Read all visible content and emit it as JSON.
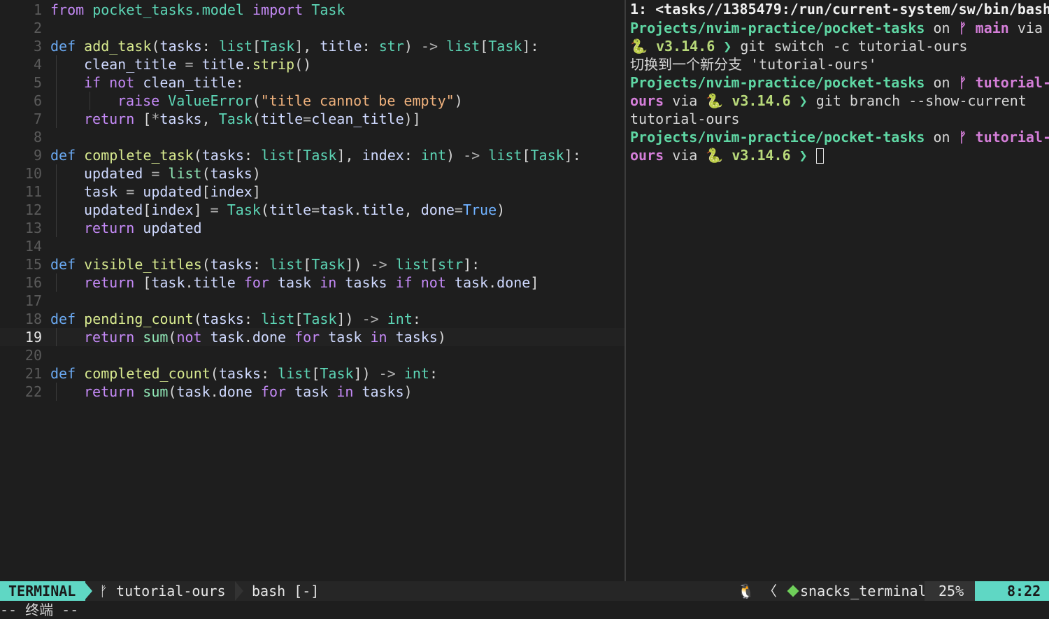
{
  "editor": {
    "current_line": 19,
    "lines": [
      {
        "n": "1",
        "tokens": [
          [
            "kw",
            "from"
          ],
          [
            "pu",
            " "
          ],
          [
            "ty",
            "pocket_tasks.model"
          ],
          [
            "pu",
            " "
          ],
          [
            "kw",
            "import"
          ],
          [
            "pu",
            " "
          ],
          [
            "ty",
            "Task"
          ]
        ]
      },
      {
        "n": "2",
        "tokens": []
      },
      {
        "n": "3",
        "tokens": [
          [
            "def",
            "def"
          ],
          [
            "pu",
            " "
          ],
          [
            "fn",
            "add_task"
          ],
          [
            "pu",
            "("
          ],
          [
            "pm",
            "tasks"
          ],
          [
            "pu",
            ": "
          ],
          [
            "ty",
            "list"
          ],
          [
            "pu",
            "["
          ],
          [
            "ty",
            "Task"
          ],
          [
            "pu",
            "], "
          ],
          [
            "pm",
            "title"
          ],
          [
            "pu",
            ": "
          ],
          [
            "ty",
            "str"
          ],
          [
            "pu",
            ") "
          ],
          [
            "op",
            "->"
          ],
          [
            "pu",
            " "
          ],
          [
            "ty",
            "list"
          ],
          [
            "pu",
            "["
          ],
          [
            "ty",
            "Task"
          ],
          [
            "pu",
            "]:"
          ]
        ]
      },
      {
        "n": "4",
        "indent": 1,
        "tokens": [
          [
            "var",
            "clean_title"
          ],
          [
            "op",
            " = "
          ],
          [
            "var",
            "title"
          ],
          [
            "pu",
            "."
          ],
          [
            "fn",
            "strip"
          ],
          [
            "pu",
            "()"
          ]
        ]
      },
      {
        "n": "5",
        "indent": 1,
        "tokens": [
          [
            "kw",
            "if"
          ],
          [
            "pu",
            " "
          ],
          [
            "kw",
            "not"
          ],
          [
            "pu",
            " "
          ],
          [
            "var",
            "clean_title"
          ],
          [
            "pu",
            ":"
          ]
        ]
      },
      {
        "n": "6",
        "indent": 2,
        "tokens": [
          [
            "kw",
            "raise"
          ],
          [
            "pu",
            " "
          ],
          [
            "ty",
            "ValueError"
          ],
          [
            "pu",
            "("
          ],
          [
            "st",
            "\"title cannot be empty\""
          ],
          [
            "pu",
            ")"
          ]
        ]
      },
      {
        "n": "7",
        "indent": 1,
        "tokens": [
          [
            "kw",
            "return"
          ],
          [
            "pu",
            " ["
          ],
          [
            "op",
            "*"
          ],
          [
            "var",
            "tasks"
          ],
          [
            "pu",
            ", "
          ],
          [
            "ty",
            "Task"
          ],
          [
            "pu",
            "("
          ],
          [
            "pm",
            "title"
          ],
          [
            "op",
            "="
          ],
          [
            "var",
            "clean_title"
          ],
          [
            "pu",
            ")]"
          ]
        ]
      },
      {
        "n": "8",
        "tokens": []
      },
      {
        "n": "9",
        "tokens": [
          [
            "def",
            "def"
          ],
          [
            "pu",
            " "
          ],
          [
            "fn",
            "complete_task"
          ],
          [
            "pu",
            "("
          ],
          [
            "pm",
            "tasks"
          ],
          [
            "pu",
            ": "
          ],
          [
            "ty",
            "list"
          ],
          [
            "pu",
            "["
          ],
          [
            "ty",
            "Task"
          ],
          [
            "pu",
            "], "
          ],
          [
            "pm",
            "index"
          ],
          [
            "pu",
            ": "
          ],
          [
            "ty",
            "int"
          ],
          [
            "pu",
            ") "
          ],
          [
            "op",
            "->"
          ],
          [
            "pu",
            " "
          ],
          [
            "ty",
            "list"
          ],
          [
            "pu",
            "["
          ],
          [
            "ty",
            "Task"
          ],
          [
            "pu",
            "]:"
          ]
        ]
      },
      {
        "n": "10",
        "indent": 1,
        "tokens": [
          [
            "var",
            "updated"
          ],
          [
            "op",
            " = "
          ],
          [
            "bi",
            "list"
          ],
          [
            "pu",
            "("
          ],
          [
            "var",
            "tasks"
          ],
          [
            "pu",
            ")"
          ]
        ]
      },
      {
        "n": "11",
        "indent": 1,
        "tokens": [
          [
            "var",
            "task"
          ],
          [
            "op",
            " = "
          ],
          [
            "var",
            "updated"
          ],
          [
            "pu",
            "["
          ],
          [
            "var",
            "index"
          ],
          [
            "pu",
            "]"
          ]
        ]
      },
      {
        "n": "12",
        "indent": 1,
        "tokens": [
          [
            "var",
            "updated"
          ],
          [
            "pu",
            "["
          ],
          [
            "var",
            "index"
          ],
          [
            "pu",
            "]"
          ],
          [
            "op",
            " = "
          ],
          [
            "ty",
            "Task"
          ],
          [
            "pu",
            "("
          ],
          [
            "pm",
            "title"
          ],
          [
            "op",
            "="
          ],
          [
            "var",
            "task"
          ],
          [
            "pu",
            "."
          ],
          [
            "var",
            "title"
          ],
          [
            "pu",
            ", "
          ],
          [
            "pm",
            "done"
          ],
          [
            "op",
            "="
          ],
          [
            "co",
            "True"
          ],
          [
            "pu",
            ")"
          ]
        ]
      },
      {
        "n": "13",
        "indent": 1,
        "tokens": [
          [
            "kw",
            "return"
          ],
          [
            "pu",
            " "
          ],
          [
            "var",
            "updated"
          ]
        ]
      },
      {
        "n": "14",
        "tokens": []
      },
      {
        "n": "15",
        "tokens": [
          [
            "def",
            "def"
          ],
          [
            "pu",
            " "
          ],
          [
            "fn",
            "visible_titles"
          ],
          [
            "pu",
            "("
          ],
          [
            "pm",
            "tasks"
          ],
          [
            "pu",
            ": "
          ],
          [
            "ty",
            "list"
          ],
          [
            "pu",
            "["
          ],
          [
            "ty",
            "Task"
          ],
          [
            "pu",
            "]) "
          ],
          [
            "op",
            "->"
          ],
          [
            "pu",
            " "
          ],
          [
            "ty",
            "list"
          ],
          [
            "pu",
            "["
          ],
          [
            "ty",
            "str"
          ],
          [
            "pu",
            "]:"
          ]
        ]
      },
      {
        "n": "16",
        "indent": 1,
        "tokens": [
          [
            "kw",
            "return"
          ],
          [
            "pu",
            " ["
          ],
          [
            "var",
            "task"
          ],
          [
            "pu",
            "."
          ],
          [
            "var",
            "title"
          ],
          [
            "pu",
            " "
          ],
          [
            "kw",
            "for"
          ],
          [
            "pu",
            " "
          ],
          [
            "var",
            "task"
          ],
          [
            "pu",
            " "
          ],
          [
            "kw",
            "in"
          ],
          [
            "pu",
            " "
          ],
          [
            "var",
            "tasks"
          ],
          [
            "pu",
            " "
          ],
          [
            "kw",
            "if"
          ],
          [
            "pu",
            " "
          ],
          [
            "kw",
            "not"
          ],
          [
            "pu",
            " "
          ],
          [
            "var",
            "task"
          ],
          [
            "pu",
            "."
          ],
          [
            "var",
            "done"
          ],
          [
            "pu",
            "]"
          ]
        ]
      },
      {
        "n": "17",
        "tokens": []
      },
      {
        "n": "18",
        "tokens": [
          [
            "def",
            "def"
          ],
          [
            "pu",
            " "
          ],
          [
            "fn",
            "pending_count"
          ],
          [
            "pu",
            "("
          ],
          [
            "pm",
            "tasks"
          ],
          [
            "pu",
            ": "
          ],
          [
            "ty",
            "list"
          ],
          [
            "pu",
            "["
          ],
          [
            "ty",
            "Task"
          ],
          [
            "pu",
            "]) "
          ],
          [
            "op",
            "->"
          ],
          [
            "pu",
            " "
          ],
          [
            "ty",
            "int"
          ],
          [
            "pu",
            ":"
          ]
        ]
      },
      {
        "n": "19",
        "indent": 1,
        "tokens": [
          [
            "kw",
            "return"
          ],
          [
            "pu",
            " "
          ],
          [
            "bi",
            "sum"
          ],
          [
            "pu",
            "("
          ],
          [
            "kw",
            "not"
          ],
          [
            "pu",
            " "
          ],
          [
            "var",
            "task"
          ],
          [
            "pu",
            "."
          ],
          [
            "var",
            "done"
          ],
          [
            "pu",
            " "
          ],
          [
            "kw",
            "for"
          ],
          [
            "pu",
            " "
          ],
          [
            "var",
            "task"
          ],
          [
            "pu",
            " "
          ],
          [
            "kw",
            "in"
          ],
          [
            "pu",
            " "
          ],
          [
            "var",
            "tasks"
          ],
          [
            "pu",
            ")"
          ]
        ]
      },
      {
        "n": "20",
        "tokens": []
      },
      {
        "n": "21",
        "tokens": [
          [
            "def",
            "def"
          ],
          [
            "pu",
            " "
          ],
          [
            "fn",
            "completed_count"
          ],
          [
            "pu",
            "("
          ],
          [
            "pm",
            "tasks"
          ],
          [
            "pu",
            ": "
          ],
          [
            "ty",
            "list"
          ],
          [
            "pu",
            "["
          ],
          [
            "ty",
            "Task"
          ],
          [
            "pu",
            "]) "
          ],
          [
            "op",
            "->"
          ],
          [
            "pu",
            " "
          ],
          [
            "ty",
            "int"
          ],
          [
            "pu",
            ":"
          ]
        ]
      },
      {
        "n": "22",
        "indent": 1,
        "tokens": [
          [
            "kw",
            "return"
          ],
          [
            "pu",
            " "
          ],
          [
            "bi",
            "sum"
          ],
          [
            "pu",
            "("
          ],
          [
            "var",
            "task"
          ],
          [
            "pu",
            "."
          ],
          [
            "var",
            "done"
          ],
          [
            "pu",
            " "
          ],
          [
            "kw",
            "for"
          ],
          [
            "pu",
            " "
          ],
          [
            "var",
            "task"
          ],
          [
            "pu",
            " "
          ],
          [
            "kw",
            "in"
          ],
          [
            "pu",
            " "
          ],
          [
            "var",
            "tasks"
          ],
          [
            "pu",
            ")"
          ]
        ]
      }
    ]
  },
  "terminal": {
    "title": "1: <tasks//1385479:/run/current-system/sw/bin/bash",
    "lines": [
      [
        [
          "t-path",
          "Projects/nvim-practice/pocket-tasks"
        ],
        [
          "t-dim",
          " on "
        ],
        [
          "t-branch",
          "ᚠ main"
        ],
        [
          "t-dim",
          " via"
        ]
      ],
      [
        [
          "t-ver",
          "🐍 v3.14.6"
        ],
        [
          "t-prompt",
          " ❯ "
        ],
        [
          "t-cmd",
          "git switch -c tutorial-ours"
        ]
      ],
      [
        [
          "t-cmd",
          "切换到一个新分支 'tutorial-ours'"
        ]
      ],
      [
        [
          "t-path",
          "Projects/nvim-practice/pocket-tasks"
        ],
        [
          "t-dim",
          " on "
        ],
        [
          "t-branch",
          "ᚠ tutorial-"
        ]
      ],
      [
        [
          "t-branch",
          "ours"
        ],
        [
          "t-dim",
          " via "
        ],
        [
          "t-ver",
          "🐍 v3.14.6"
        ],
        [
          "t-prompt",
          " ❯ "
        ],
        [
          "t-cmd",
          "git branch --show-current"
        ]
      ],
      [
        [
          "t-cmd",
          "tutorial-ours"
        ]
      ],
      [
        [
          "t-path",
          "Projects/nvim-practice/pocket-tasks"
        ],
        [
          "t-dim",
          " on "
        ],
        [
          "t-branch",
          "ᚠ tutorial-"
        ]
      ],
      [
        [
          "t-branch",
          "ours"
        ],
        [
          "t-dim",
          " via "
        ],
        [
          "t-ver",
          "🐍 v3.14.6"
        ],
        [
          "t-prompt",
          " ❯ "
        ]
      ]
    ]
  },
  "statusbar": {
    "mode": "TERMINAL",
    "branch": "ᚠ tutorial-ours",
    "buffer": "bash [-]",
    "right_icons": "🐧 〈",
    "filetype": "snacks_terminal",
    "percent": "25%",
    "position": "8:22"
  },
  "cmdline": "-- 终端 --",
  "icons": {
    "branch": "branch-icon",
    "linux": "linux-icon",
    "filetype": "cube-icon",
    "python": "python-icon"
  }
}
